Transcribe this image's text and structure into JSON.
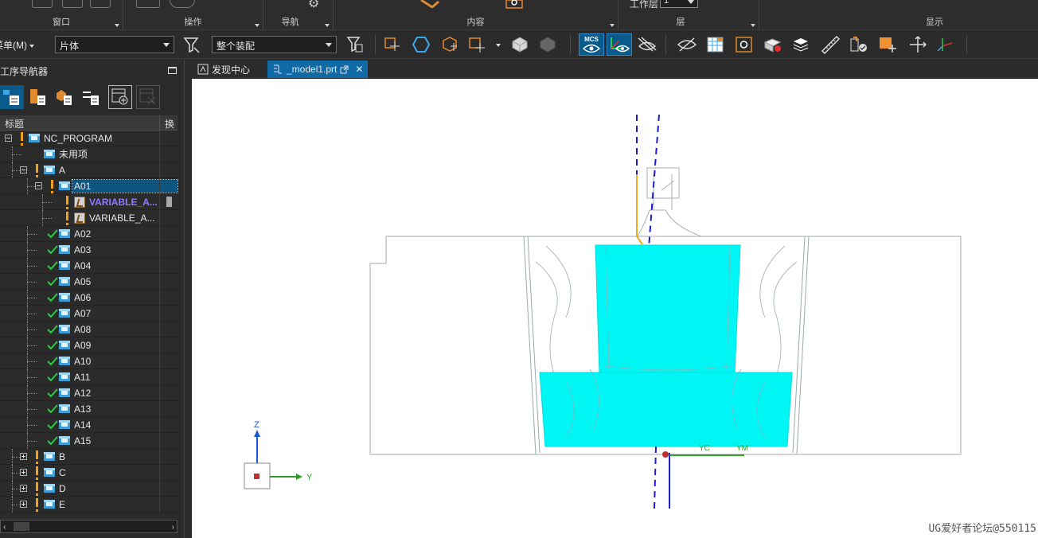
{
  "ribbon": {
    "groups": [
      {
        "label": "窗口"
      },
      {
        "label": "操作"
      },
      {
        "label": "导航"
      },
      {
        "label": "内容"
      },
      {
        "label": "层"
      },
      {
        "label": "显示"
      }
    ],
    "work_layer_label": "工作层",
    "work_layer_value": "1"
  },
  "toolbar": {
    "menu_label": "菜单(M)",
    "filter_select": "片体",
    "scope_select": "整个装配",
    "mcs_label": "MCS"
  },
  "navigator": {
    "title": "工序导航器",
    "column_title": "标题",
    "column_change": "换",
    "tree": [
      {
        "label": "NC_PROGRAM",
        "status": "warn",
        "depth": 0,
        "expander": "minus",
        "icon": "folder"
      },
      {
        "label": "未用项",
        "status": "none",
        "depth": 1,
        "expander": "none",
        "icon": "folder"
      },
      {
        "label": "A",
        "status": "warn",
        "depth": 1,
        "expander": "minus",
        "icon": "folder"
      },
      {
        "label": "A01",
        "status": "warn",
        "depth": 2,
        "expander": "minus",
        "icon": "folder",
        "selected": true
      },
      {
        "label": "VARIABLE_A...",
        "status": "warn",
        "depth": 3,
        "expander": "none",
        "icon": "op",
        "highlight": true
      },
      {
        "label": "VARIABLE_A...",
        "status": "warn",
        "depth": 3,
        "expander": "none",
        "icon": "op"
      },
      {
        "label": "A02",
        "status": "ok",
        "depth": 2,
        "expander": "none",
        "icon": "folder"
      },
      {
        "label": "A03",
        "status": "ok",
        "depth": 2,
        "expander": "none",
        "icon": "folder"
      },
      {
        "label": "A04",
        "status": "ok",
        "depth": 2,
        "expander": "none",
        "icon": "folder"
      },
      {
        "label": "A05",
        "status": "ok",
        "depth": 2,
        "expander": "none",
        "icon": "folder"
      },
      {
        "label": "A06",
        "status": "ok",
        "depth": 2,
        "expander": "none",
        "icon": "folder"
      },
      {
        "label": "A07",
        "status": "ok",
        "depth": 2,
        "expander": "none",
        "icon": "folder"
      },
      {
        "label": "A08",
        "status": "ok",
        "depth": 2,
        "expander": "none",
        "icon": "folder"
      },
      {
        "label": "A09",
        "status": "ok",
        "depth": 2,
        "expander": "none",
        "icon": "folder"
      },
      {
        "label": "A10",
        "status": "ok",
        "depth": 2,
        "expander": "none",
        "icon": "folder"
      },
      {
        "label": "A11",
        "status": "ok",
        "depth": 2,
        "expander": "none",
        "icon": "folder"
      },
      {
        "label": "A12",
        "status": "ok",
        "depth": 2,
        "expander": "none",
        "icon": "folder"
      },
      {
        "label": "A13",
        "status": "ok",
        "depth": 2,
        "expander": "none",
        "icon": "folder"
      },
      {
        "label": "A14",
        "status": "ok",
        "depth": 2,
        "expander": "none",
        "icon": "folder"
      },
      {
        "label": "A15",
        "status": "ok",
        "depth": 2,
        "expander": "none",
        "icon": "folder"
      },
      {
        "label": "B",
        "status": "warn",
        "depth": 1,
        "expander": "plus",
        "icon": "folder"
      },
      {
        "label": "C",
        "status": "warn",
        "depth": 1,
        "expander": "plus",
        "icon": "folder"
      },
      {
        "label": "D",
        "status": "warn",
        "depth": 1,
        "expander": "plus",
        "icon": "folder"
      },
      {
        "label": "E",
        "status": "warn",
        "depth": 1,
        "expander": "plus",
        "icon": "folder"
      }
    ]
  },
  "tabs": [
    {
      "label": "发现中心",
      "active": false
    },
    {
      "label": "_model1.prt",
      "active": true
    }
  ],
  "viewport": {
    "axis_z": "Z",
    "axis_y": "Y",
    "mcs_label_1": "YC",
    "mcs_label_2": "YM",
    "watermark": "UG爱好者论坛@550115"
  },
  "colors": {
    "accent": "#0f6aa6",
    "part_fill": "#00f5f5",
    "status_ok": "#2ecc40",
    "status_warn": "#f0a020"
  }
}
